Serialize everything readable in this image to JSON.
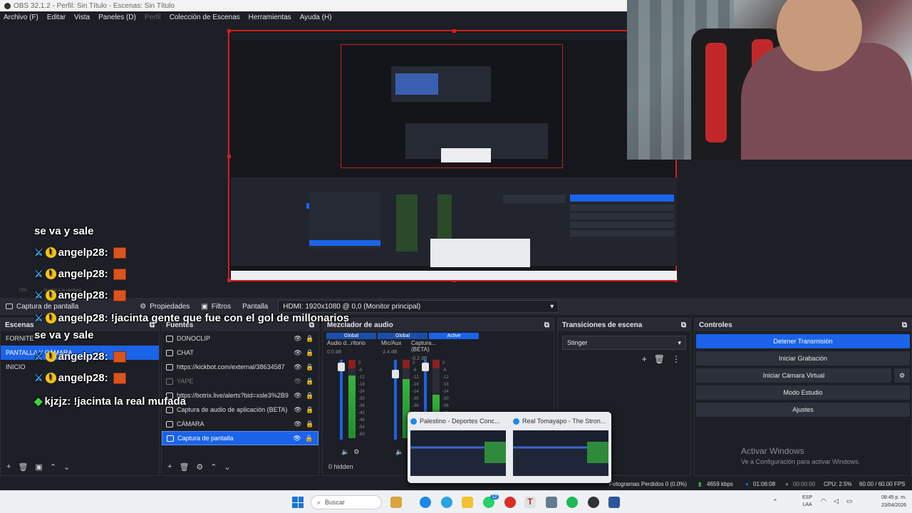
{
  "window": {
    "title": "OBS 32.1.2 - Perfil: Sin Título - Escenas: Sin Título"
  },
  "menu": [
    {
      "label": "Archivo (F)",
      "dim": false
    },
    {
      "label": "Editar",
      "dim": false
    },
    {
      "label": "Vista",
      "dim": false
    },
    {
      "label": "Paneles (D)",
      "dim": false
    },
    {
      "label": "Perfil",
      "dim": true
    },
    {
      "label": "Colección de Escenas",
      "dim": false
    },
    {
      "label": "Herramientas",
      "dim": false
    },
    {
      "label": "Ayuda (H)",
      "dim": false
    }
  ],
  "chat": [
    {
      "text": "se va y sale",
      "type": "plain"
    },
    {
      "text": "angelp28:",
      "type": "user"
    },
    {
      "text": "angelp28:",
      "type": "user"
    },
    {
      "text": "angelp28:",
      "type": "user"
    },
    {
      "text": "angelp28: !jacinta gente que fue con el gol de millonarios",
      "type": "user-msg"
    },
    {
      "text": "se va y sale",
      "type": "plain"
    },
    {
      "text": "angelp28:",
      "type": "user"
    },
    {
      "text": "angelp28:",
      "type": "user"
    },
    {
      "text": "kjzjz: !jacinta la real mufada",
      "type": "gem"
    }
  ],
  "statusline": {
    "zoom": "73%",
    "hint": "Ajustar a la ventana"
  },
  "sourcebar": {
    "capture": "Captura de pantalla",
    "properties": "Propiedades",
    "filters": "Filtros",
    "screen_label": "Pantalla",
    "screen_value": "HDMI: 1920x1080 @ 0,0 (Monitor principal)"
  },
  "scenes": {
    "title": "Escenas",
    "items": [
      {
        "label": "FORNITE",
        "active": false
      },
      {
        "label": "PANTALLA Y CÁMARA",
        "active": true
      },
      {
        "label": "INICIO",
        "active": false
      }
    ]
  },
  "sources": {
    "title": "Fuentes",
    "items": [
      {
        "label": "DONOCLIP",
        "dim": false,
        "active": false
      },
      {
        "label": "CHAT",
        "dim": false,
        "active": false
      },
      {
        "label": "https://kickbot.com/external/38634587",
        "dim": false,
        "active": false
      },
      {
        "label": "YAPE",
        "dim": true,
        "active": false
      },
      {
        "label": "https://botrix.live/alerts?bid=xsle3%2B9",
        "dim": false,
        "active": false
      },
      {
        "label": "Captura de audio de aplicación (BETA)",
        "dim": false,
        "active": false
      },
      {
        "label": "CÁMARA",
        "dim": false,
        "active": false
      },
      {
        "label": "Captura de pantalla",
        "dim": false,
        "active": true
      }
    ]
  },
  "mixer": {
    "title": "Mezclador de audio",
    "tabs": [
      "Global",
      "Global",
      "Active"
    ],
    "channels": [
      {
        "name": "Audio d...ritorio",
        "db": "0.0 dB",
        "level": 0.8
      },
      {
        "name": "Mic/Aux",
        "db": "-2.4 dB",
        "level": 0.75
      },
      {
        "name": "Captura... (BETA)",
        "db": "-0.2 dB",
        "level": 0.55
      }
    ],
    "scale": [
      "0",
      "-6",
      "-12",
      "-18",
      "-24",
      "-30",
      "-36",
      "-42",
      "-48",
      "-54",
      "-60"
    ],
    "hidden": "0 hidden"
  },
  "transitions": {
    "title": "Transiciones de escena",
    "selected": "Stinger"
  },
  "controls": {
    "title": "Controles",
    "buttons": [
      "Detener Transmisión",
      "Iniciar Grabación",
      "Iniciar Cámara Virtual",
      "Modo Estudio",
      "Ajustes"
    ]
  },
  "activation": {
    "title": "Activar Windows",
    "subtitle": "Ve a Configuración para activar Windows."
  },
  "thumbnails": [
    {
      "title": "Palestino - Deportes Conc..."
    },
    {
      "title": "Real Tomayapo - The Stron..."
    }
  ],
  "obs_status": {
    "dropped": "Fotogramas Perdidos 0 (0.0%)",
    "kbps": "4659 kbps",
    "stream_time": "01:06:08",
    "rec_time": "00:00:00",
    "cpu": "CPU: 2.5%",
    "fps": "60.00 / 60.00 FPS"
  },
  "taskbar": {
    "search": "Buscar",
    "lang1": "ESP",
    "lang2": "LAA",
    "time": "08:45 p. m.",
    "date": "23/04/2026",
    "badge": "12"
  },
  "colors": {
    "accent": "#1b63e8",
    "recording_red": "#d21f1f",
    "panel_bg": "#1d1f26"
  }
}
